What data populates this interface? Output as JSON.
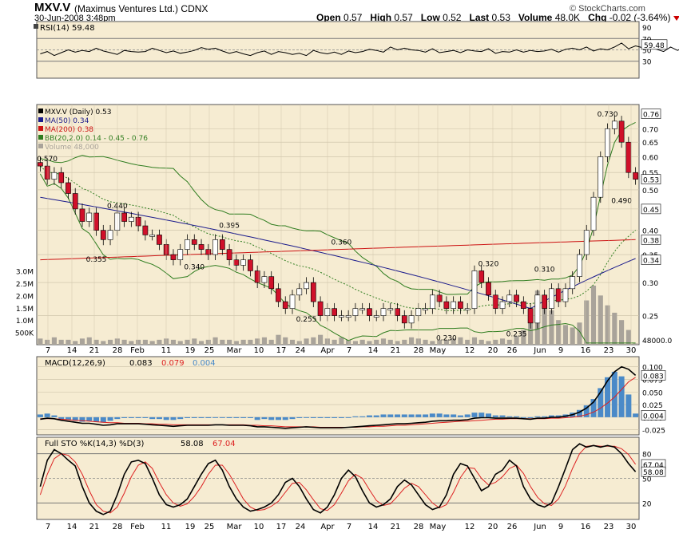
{
  "header": {
    "symbol": "MXV.V",
    "company": "(Maximus Ventures Ltd.)",
    "exchange": "CDNX",
    "date": "30-Jun-2008 3:48pm",
    "credit": "© StockCharts.com",
    "open_label": "Open",
    "open": "0.57",
    "high_label": "High",
    "high": "0.57",
    "low_label": "Low",
    "low": "0.52",
    "last_label": "Last",
    "last": "0.53",
    "volume_label": "Volume",
    "volume": "48.0K",
    "chg_label": "Chg",
    "chg": "-0.02 (-3.64%)"
  },
  "colors": {
    "panel_bg": "#f6ecd2",
    "up_candle": "#ffffff",
    "down_candle": "#d0102a",
    "ma50": "#1a1a8c",
    "ma200": "#cc1111",
    "bollinger": "#2f7d1f",
    "volume": "#a9a39a",
    "macd_hist": "#4a8ac8",
    "signal": "#dd2222",
    "line": "#000000",
    "rsi_fill": "#4a6a1f"
  },
  "chart_data": [
    {
      "type": "line",
      "title": "RSI(14) 59.48",
      "panel": "rsi",
      "ylim": [
        0,
        100
      ],
      "y_ticks": [
        "90",
        "70",
        "50",
        "30"
      ],
      "reference_lines": [
        70,
        30
      ],
      "last_value": "59.48",
      "values": [
        43,
        47,
        40,
        45,
        50,
        46,
        49,
        47,
        53,
        48,
        45,
        42,
        49,
        47,
        46,
        47,
        53,
        49,
        45,
        48,
        44,
        46,
        49,
        54,
        51,
        53,
        48,
        44,
        47,
        43,
        40,
        45,
        48,
        42,
        47,
        45,
        42,
        44,
        40,
        49,
        45,
        43,
        46,
        42,
        48,
        45,
        47,
        51,
        49,
        46,
        55,
        50,
        53,
        50,
        49,
        46,
        52,
        45,
        47,
        49,
        45,
        50,
        48,
        47,
        52,
        44,
        47,
        46,
        50,
        46,
        49,
        47,
        48,
        51,
        46,
        51,
        53,
        50,
        55,
        48,
        52,
        50,
        55,
        62,
        52,
        57,
        54,
        53,
        51,
        47,
        55,
        49,
        56,
        62,
        64,
        66,
        72,
        79,
        79,
        80,
        77,
        68,
        64,
        59.48
      ]
    },
    {
      "type": "line",
      "title": "MXV.V (Daily) 0.53",
      "panel": "price",
      "scale": "log",
      "ylim": [
        0.213,
        0.8
      ],
      "y_ticks": [
        "0.70",
        "0.65",
        "0.60",
        "0.55",
        "0.50",
        "0.45",
        "0.40",
        "0.35",
        "0.30",
        "0.25"
      ],
      "x_ticks": [
        "7",
        "14",
        "21",
        "28",
        "Feb",
        "11",
        "19",
        "25",
        "Mar",
        "10",
        "17",
        "24",
        "Apr",
        "7",
        "14",
        "21",
        "28",
        "May",
        "12",
        "20",
        "26",
        "Jun",
        "9",
        "16",
        "23",
        "30"
      ],
      "legend": [
        {
          "label": "MXV.V (Daily) 0.53",
          "color": "#000000"
        },
        {
          "label": "MA(50) 0.34",
          "color": "#1a1a8c"
        },
        {
          "label": "MA(200) 0.38",
          "color": "#cc1111"
        },
        {
          "label": "BB(20,2.0) 0.14 - 0.45 - 0.76",
          "color": "#2f7d1f"
        },
        {
          "label": "Volume 48,000",
          "color": "#a9a39a"
        }
      ],
      "close": [
        0.57,
        0.53,
        0.55,
        0.52,
        0.49,
        0.45,
        0.42,
        0.44,
        0.4,
        0.38,
        0.4,
        0.44,
        0.42,
        0.43,
        0.41,
        0.39,
        0.39,
        0.37,
        0.35,
        0.34,
        0.36,
        0.38,
        0.37,
        0.36,
        0.35,
        0.38,
        0.36,
        0.34,
        0.33,
        0.34,
        0.32,
        0.3,
        0.31,
        0.29,
        0.27,
        0.26,
        0.28,
        0.29,
        0.3,
        0.27,
        0.25,
        0.26,
        0.25,
        0.25,
        0.25,
        0.26,
        0.26,
        0.25,
        0.25,
        0.26,
        0.26,
        0.25,
        0.24,
        0.25,
        0.26,
        0.26,
        0.28,
        0.27,
        0.26,
        0.27,
        0.26,
        0.26,
        0.32,
        0.3,
        0.28,
        0.26,
        0.27,
        0.28,
        0.27,
        0.26,
        0.24,
        0.28,
        0.26,
        0.29,
        0.27,
        0.29,
        0.31,
        0.35,
        0.4,
        0.48,
        0.6,
        0.7,
        0.73,
        0.65,
        0.55,
        0.53
      ],
      "annotations": [
        {
          "label": "0.570",
          "x_index": 1,
          "y": 0.57,
          "pos": "above"
        },
        {
          "label": "0.440",
          "x_index": 11,
          "y": 0.44,
          "pos": "above"
        },
        {
          "label": "0.355",
          "x_index": 8,
          "y": 0.355,
          "pos": "below"
        },
        {
          "label": "0.395",
          "x_index": 27,
          "y": 0.395,
          "pos": "above"
        },
        {
          "label": "0.340",
          "x_index": 22,
          "y": 0.34,
          "pos": "below"
        },
        {
          "label": "0.360",
          "x_index": 43,
          "y": 0.36,
          "pos": "above"
        },
        {
          "label": "0.255",
          "x_index": 38,
          "y": 0.255,
          "pos": "below"
        },
        {
          "label": "0.230",
          "x_index": 58,
          "y": 0.23,
          "pos": "below"
        },
        {
          "label": "0.320",
          "x_index": 64,
          "y": 0.32,
          "pos": "above"
        },
        {
          "label": "0.310",
          "x_index": 72,
          "y": 0.31,
          "pos": "above"
        },
        {
          "label": "0.235",
          "x_index": 68,
          "y": 0.235,
          "pos": "below"
        },
        {
          "label": "0.730",
          "x_index": 81,
          "y": 0.73,
          "pos": "above"
        },
        {
          "label": "0.490",
          "x_index": 83,
          "y": 0.49,
          "pos": "below"
        }
      ],
      "right_labels": [
        {
          "label": "0.76",
          "y": 0.76
        },
        {
          "label": "0.53",
          "y": 0.53
        },
        {
          "label": "0.45",
          "y": 0.45
        },
        {
          "label": "0.38",
          "y": 0.38
        },
        {
          "label": "0.34",
          "y": 0.34
        }
      ]
    },
    {
      "type": "bar",
      "panel": "volume",
      "title": "Volume 48,000",
      "y_ticks": [
        "3.0M",
        "2.5M",
        "2.0M",
        "1.5M",
        "1.0M",
        "500K"
      ],
      "last_value": "48000.0",
      "values": [
        0.25,
        0.2,
        0.3,
        0.2,
        0.2,
        0.15,
        0.25,
        0.3,
        0.2,
        0.15,
        0.2,
        0.25,
        0.2,
        0.15,
        0.2,
        0.2,
        0.15,
        0.2,
        0.25,
        0.2,
        0.15,
        0.2,
        0.25,
        0.15,
        0.2,
        0.3,
        0.2,
        0.2,
        0.15,
        0.2,
        0.2,
        0.25,
        0.3,
        0.2,
        0.4,
        0.3,
        0.2,
        0.15,
        0.25,
        0.3,
        0.4,
        0.25,
        0.2,
        0.3,
        0.2,
        0.15,
        0.2,
        0.15,
        0.2,
        0.25,
        0.2,
        0.15,
        0.2,
        0.3,
        0.25,
        0.2,
        0.15,
        0.2,
        0.2,
        0.25,
        0.3,
        0.2,
        0.3,
        0.2,
        0.15,
        0.2,
        0.25,
        0.2,
        0.35,
        0.6,
        1.2,
        2.2,
        1.8,
        1.4,
        1.0,
        0.8,
        0.7,
        0.9,
        1.8,
        2.4,
        2.0,
        1.6,
        1.3,
        1.0,
        0.6,
        0.05
      ]
    },
    {
      "type": "line",
      "panel": "macd",
      "title": "MACD(12,26,9)",
      "legend_values": [
        "0.083",
        "0.079",
        "0.004"
      ],
      "y_ticks": [
        "0.100",
        "0.075",
        "0.050",
        "0.025",
        "0.000",
        "-0.025"
      ],
      "ylim": [
        -0.035,
        0.12
      ],
      "series": [
        {
          "values": [
            -0.004,
            -0.002,
            -0.003,
            -0.006,
            -0.008,
            -0.01,
            -0.012,
            -0.012,
            -0.014,
            -0.016,
            -0.015,
            -0.013,
            -0.013,
            -0.013,
            -0.013,
            -0.014,
            -0.015,
            -0.016,
            -0.017,
            -0.018,
            -0.017,
            -0.016,
            -0.016,
            -0.016,
            -0.016,
            -0.015,
            -0.015,
            -0.016,
            -0.016,
            -0.016,
            -0.017,
            -0.019,
            -0.019,
            -0.02,
            -0.021,
            -0.022,
            -0.021,
            -0.02,
            -0.019,
            -0.02,
            -0.021,
            -0.021,
            -0.021,
            -0.021,
            -0.02,
            -0.019,
            -0.018,
            -0.017,
            -0.016,
            -0.015,
            -0.014,
            -0.013,
            -0.013,
            -0.012,
            -0.011,
            -0.01,
            -0.008,
            -0.007,
            -0.007,
            -0.006,
            -0.006,
            -0.005,
            -0.002,
            -0.001,
            -0.001,
            -0.002,
            -0.002,
            -0.002,
            -0.002,
            -0.003,
            -0.004,
            -0.002,
            -0.002,
            0.0,
            0.0,
            0.002,
            0.005,
            0.01,
            0.018,
            0.03,
            0.05,
            0.072,
            0.09,
            0.1,
            0.095,
            0.083
          ]
        },
        {
          "values": [
            -0.003,
            -0.003,
            -0.003,
            -0.004,
            -0.005,
            -0.006,
            -0.007,
            -0.008,
            -0.009,
            -0.01,
            -0.011,
            -0.011,
            -0.012,
            -0.012,
            -0.012,
            -0.013,
            -0.013,
            -0.014,
            -0.014,
            -0.015,
            -0.015,
            -0.015,
            -0.015,
            -0.015,
            -0.015,
            -0.015,
            -0.015,
            -0.015,
            -0.015,
            -0.015,
            -0.016,
            -0.016,
            -0.017,
            -0.017,
            -0.018,
            -0.019,
            -0.019,
            -0.019,
            -0.019,
            -0.019,
            -0.02,
            -0.02,
            -0.02,
            -0.02,
            -0.02,
            -0.02,
            -0.019,
            -0.019,
            -0.018,
            -0.018,
            -0.017,
            -0.016,
            -0.016,
            -0.015,
            -0.014,
            -0.013,
            -0.012,
            -0.011,
            -0.01,
            -0.009,
            -0.008,
            -0.008,
            -0.007,
            -0.006,
            -0.005,
            -0.004,
            -0.004,
            -0.003,
            -0.003,
            -0.003,
            -0.003,
            -0.003,
            -0.003,
            -0.002,
            -0.002,
            -0.001,
            0.0,
            0.002,
            0.005,
            0.01,
            0.018,
            0.028,
            0.04,
            0.055,
            0.07,
            0.079
          ]
        },
        {
          "values": [
            0.003,
            0.004,
            0.002,
            -0.002,
            -0.003,
            -0.004,
            -0.005,
            -0.004,
            -0.005,
            -0.006,
            -0.004,
            -0.002,
            -0.001,
            -0.001,
            -0.001,
            -0.001,
            -0.002,
            -0.002,
            -0.003,
            -0.003,
            -0.002,
            -0.001,
            -0.001,
            -0.001,
            -0.001,
            0.0,
            0.0,
            -0.001,
            -0.001,
            -0.001,
            -0.001,
            -0.003,
            -0.002,
            -0.003,
            -0.003,
            -0.003,
            -0.002,
            -0.001,
            0.0,
            -0.001,
            -0.001,
            -0.001,
            -0.001,
            -0.001,
            0.0,
            0.001,
            0.001,
            0.002,
            0.002,
            0.003,
            0.003,
            0.003,
            0.003,
            0.003,
            0.003,
            0.003,
            0.004,
            0.004,
            0.003,
            0.003,
            0.002,
            0.003,
            0.005,
            0.005,
            0.004,
            0.002,
            0.002,
            0.001,
            0.001,
            0.0,
            -0.001,
            0.001,
            0.001,
            0.002,
            0.002,
            0.003,
            0.005,
            0.008,
            0.013,
            0.02,
            0.032,
            0.044,
            0.05,
            0.045,
            0.025,
            0.004
          ]
        }
      ]
    },
    {
      "type": "line",
      "panel": "sto",
      "title": "Full STO %K(14,3) %D(3)",
      "legend_values": [
        "58.08",
        "67.04"
      ],
      "ylim": [
        0,
        100
      ],
      "y_ticks": [
        "80",
        "50",
        "20"
      ],
      "reference_lines": [
        80,
        20
      ],
      "x_ticks": [
        "7",
        "14",
        "21",
        "28",
        "Feb",
        "11",
        "19",
        "25",
        "Mar",
        "10",
        "17",
        "24",
        "Apr",
        "7",
        "14",
        "21",
        "28",
        "May",
        "12",
        "20",
        "26",
        "Jun",
        "9",
        "16",
        "23",
        "30"
      ],
      "series": [
        {
          "values": [
            40,
            72,
            85,
            80,
            72,
            65,
            40,
            20,
            10,
            6,
            10,
            30,
            55,
            70,
            72,
            68,
            50,
            30,
            18,
            15,
            18,
            25,
            40,
            55,
            68,
            72,
            60,
            40,
            25,
            15,
            10,
            12,
            15,
            20,
            30,
            45,
            50,
            40,
            25,
            12,
            8,
            15,
            30,
            50,
            60,
            52,
            35,
            20,
            15,
            18,
            25,
            40,
            48,
            42,
            30,
            18,
            12,
            15,
            30,
            55,
            68,
            65,
            50,
            35,
            40,
            55,
            60,
            72,
            65,
            40,
            25,
            18,
            15,
            20,
            40,
            62,
            85,
            92,
            88,
            90,
            88,
            90,
            88,
            80,
            68,
            58.08
          ]
        },
        {
          "values": [
            30,
            55,
            74,
            80,
            78,
            70,
            55,
            35,
            18,
            10,
            8,
            15,
            32,
            52,
            66,
            70,
            62,
            45,
            30,
            20,
            16,
            19,
            28,
            40,
            55,
            66,
            66,
            55,
            40,
            25,
            15,
            11,
            12,
            16,
            22,
            33,
            44,
            45,
            36,
            24,
            13,
            11,
            18,
            32,
            47,
            55,
            50,
            36,
            23,
            17,
            19,
            28,
            38,
            44,
            40,
            30,
            20,
            14,
            18,
            33,
            51,
            63,
            62,
            50,
            42,
            45,
            52,
            62,
            66,
            56,
            40,
            27,
            19,
            17,
            25,
            41,
            62,
            80,
            89,
            90,
            89,
            89,
            89,
            86,
            79,
            67.04
          ]
        }
      ]
    }
  ]
}
